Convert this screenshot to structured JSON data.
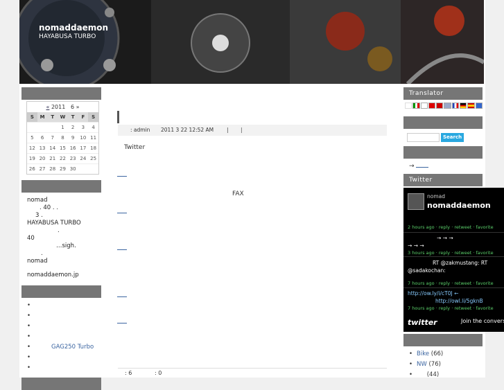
{
  "header": {
    "title": "nomaddaemon",
    "subtitle": "HAYABUSA TURBO"
  },
  "calendar": {
    "prev": "«",
    "year": "2011",
    "month": "6",
    "next": "»",
    "weekdays": [
      "S",
      "M",
      "T",
      "W",
      "T",
      "F",
      "S"
    ],
    "rows": [
      [
        "",
        "",
        "",
        "1",
        "2",
        "3",
        "4"
      ],
      [
        "5",
        "6",
        "7",
        "8",
        "9",
        "10",
        "11"
      ],
      [
        "12",
        "13",
        "14",
        "15",
        "16",
        "17",
        "18"
      ],
      [
        "19",
        "20",
        "21",
        "22",
        "23",
        "24",
        "25"
      ],
      [
        "26",
        "27",
        "28",
        "29",
        "30",
        "",
        ""
      ]
    ]
  },
  "about": {
    "lines": [
      "nomad",
      ". 40 .   .",
      "3     .",
      "HAYABUSA TURBO",
      ".",
      "40",
      "…sigh.",
      ".",
      "nomad",
      "",
      "nomaddaemon.jp"
    ]
  },
  "links": {
    "gag_label": "GAG250 Turbo"
  },
  "post": {
    "author": ": admin",
    "date": "2011 3 22  12:52 AM",
    "separator": "|",
    "twitter": "Twitter",
    "fax": "FAX",
    "comments": ": 6",
    "trackbacks": ": 0"
  },
  "right": {
    "translator": "Translator",
    "search_button": "Search",
    "arrow_text": "→",
    "twitter_head": "Twitter"
  },
  "twitter_widget": {
    "user": "nomad",
    "name": "nomaddaemon",
    "time1": "2 hours ago · reply · retweet · favorite",
    "arrows1": "→        →         →",
    "arrows2": "→    →         →",
    "time2": "3 hours ago · reply · retweet · favorite",
    "rt1": "RT @zakmustang:       RT",
    "rt2": "@sadakochan:",
    "time3": "7 hours ago · reply · retweet · favorite",
    "link1": "http://ow.ly/i/cT0J ←",
    "link2": "http://owl.li/5gknB",
    "time4": "7 hours ago · reply · retweet · favorite",
    "logo": "twitter",
    "join": "Join the conversa"
  },
  "categories": [
    {
      "name": "Bike",
      "count": "(66)"
    },
    {
      "name": "NW",
      "count": "(76)"
    },
    {
      "name": "",
      "count": "(44)"
    }
  ],
  "colors": {
    "widget_head": "#767676",
    "link": "#3a64a0",
    "tweet_time": "#5bd06b",
    "search": "#29a8e0"
  }
}
